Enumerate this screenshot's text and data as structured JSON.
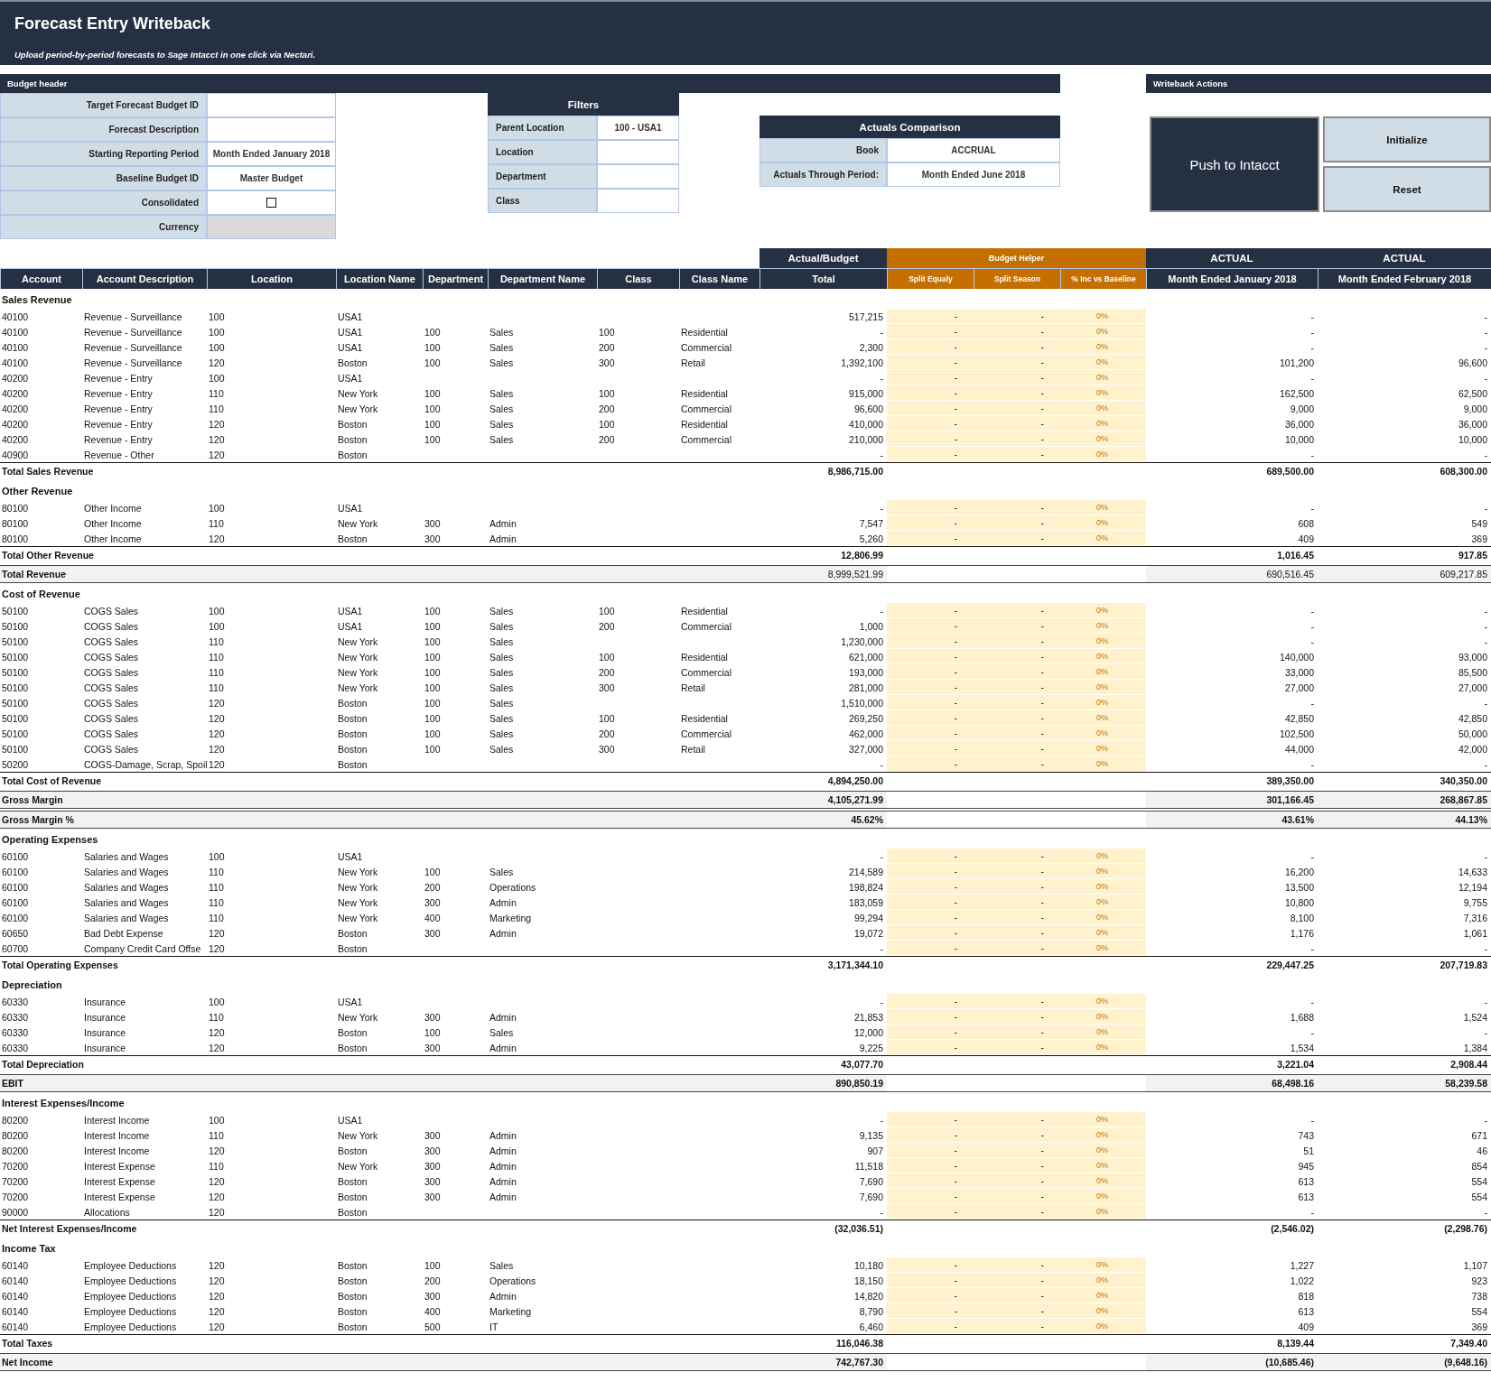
{
  "header": {
    "title": "Forecast Entry Writeback",
    "subtitle": "Upload period-by-period forecasts to Sage Intacct in one click via Nectari."
  },
  "budget_header": {
    "title": "Budget header",
    "fields": [
      {
        "label": "Target Forecast Budget ID",
        "kind": "text",
        "disabled": false
      },
      {
        "label": "Forecast Description",
        "kind": "text",
        "disabled": false
      },
      {
        "label": "Starting Reporting Period",
        "kind": "text",
        "value": "Month Ended January 2018",
        "disabled": false
      },
      {
        "label": "Baseline Budget ID",
        "kind": "text",
        "value": "Master Budget",
        "disabled": false
      },
      {
        "label": "Consolidated",
        "kind": "checkbox",
        "checked": false,
        "disabled": false
      },
      {
        "label": "Currency",
        "kind": "text",
        "disabled": true
      }
    ]
  },
  "filters": {
    "title": "Filters",
    "fields": [
      {
        "label": "Parent Location",
        "value": "100 - USA1"
      },
      {
        "label": "Location"
      },
      {
        "label": "Department"
      },
      {
        "label": "Class"
      }
    ]
  },
  "actuals_comparison": {
    "title": "Actuals Comparison",
    "fields": [
      {
        "label": "Book",
        "value": "ACCRUAL"
      },
      {
        "label": "Actuals Through Period:",
        "value": "Month Ended June 2018"
      }
    ]
  },
  "writeback_actions": {
    "title": "Writeback Actions",
    "buttons": [
      {
        "label": "Push to Intacct",
        "kind": "primary"
      },
      {
        "label": "Initialize",
        "kind": "secondary"
      },
      {
        "label": "Reset",
        "kind": "secondary"
      }
    ]
  },
  "table": {
    "column_groups": [
      {
        "kind": "plain",
        "columns": [
          "Account",
          "Account Description",
          "Location",
          "Location Name",
          "Department",
          "Department Name",
          "Class",
          "Class Name"
        ]
      },
      {
        "kind": "dark",
        "label": "Actual/Budget",
        "columns": [
          "Total"
        ]
      },
      {
        "kind": "helper",
        "label": "Budget Helper",
        "columns": [
          "Split Equaly",
          "Split Season",
          "% Inc vs Baseline"
        ]
      },
      {
        "kind": "dark",
        "label": "ACTUAL",
        "columns": [
          "Month Ended January 2018"
        ]
      },
      {
        "kind": "dark",
        "label": "ACTUAL",
        "columns": [
          "Month Ended February 2018"
        ]
      }
    ],
    "rows": [
      {
        "kind": "section",
        "label": "Sales Revenue"
      },
      {
        "kind": "line",
        "account": "40100",
        "description": "Revenue - Surveillance",
        "location": "100",
        "location_name": "USA1",
        "total": "517,215",
        "split_equally": "-",
        "split_season": "-",
        "inc_vs_baseline": "0%",
        "actual_jan": "-",
        "actual_feb": "-"
      },
      {
        "kind": "line",
        "account": "40100",
        "description": "Revenue - Surveillance",
        "location": "100",
        "location_name": "USA1",
        "department": "100",
        "department_name": "Sales",
        "class": "100",
        "class_name": "Residential",
        "total": "-",
        "split_equally": "-",
        "split_season": "-",
        "inc_vs_baseline": "0%",
        "actual_jan": "-",
        "actual_feb": "-"
      },
      {
        "kind": "line",
        "account": "40100",
        "description": "Revenue - Surveillance",
        "location": "100",
        "location_name": "USA1",
        "department": "100",
        "department_name": "Sales",
        "class": "200",
        "class_name": "Commercial",
        "total": "2,300",
        "split_equally": "-",
        "split_season": "-",
        "inc_vs_baseline": "0%",
        "actual_jan": "-",
        "actual_feb": "-"
      },
      {
        "kind": "line",
        "account": "40100",
        "description": "Revenue - Surveillance",
        "location": "120",
        "location_name": "Boston",
        "department": "100",
        "department_name": "Sales",
        "class": "300",
        "class_name": "Retail",
        "total": "1,392,100",
        "split_equally": "-",
        "split_season": "-",
        "inc_vs_baseline": "0%",
        "actual_jan": "101,200",
        "actual_feb": "96,600"
      },
      {
        "kind": "line",
        "account": "40200",
        "description": "Revenue - Entry",
        "location": "100",
        "location_name": "USA1",
        "total": "-",
        "split_equally": "-",
        "split_season": "-",
        "inc_vs_baseline": "0%",
        "actual_jan": "-",
        "actual_feb": "-"
      },
      {
        "kind": "line",
        "account": "40200",
        "description": "Revenue - Entry",
        "location": "110",
        "location_name": "New York",
        "department": "100",
        "department_name": "Sales",
        "class": "100",
        "class_name": "Residential",
        "total": "915,000",
        "split_equally": "-",
        "split_season": "-",
        "inc_vs_baseline": "0%",
        "actual_jan": "162,500",
        "actual_feb": "62,500"
      },
      {
        "kind": "line",
        "account": "40200",
        "description": "Revenue - Entry",
        "location": "110",
        "location_name": "New York",
        "department": "100",
        "department_name": "Sales",
        "class": "200",
        "class_name": "Commercial",
        "total": "96,600",
        "split_equally": "-",
        "split_season": "-",
        "inc_vs_baseline": "0%",
        "actual_jan": "9,000",
        "actual_feb": "9,000"
      },
      {
        "kind": "line",
        "account": "40200",
        "description": "Revenue - Entry",
        "location": "120",
        "location_name": "Boston",
        "department": "100",
        "department_name": "Sales",
        "class": "100",
        "class_name": "Residential",
        "total": "410,000",
        "split_equally": "-",
        "split_season": "-",
        "inc_vs_baseline": "0%",
        "actual_jan": "36,000",
        "actual_feb": "36,000"
      },
      {
        "kind": "line",
        "account": "40200",
        "description": "Revenue - Entry",
        "location": "120",
        "location_name": "Boston",
        "department": "100",
        "department_name": "Sales",
        "class": "200",
        "class_name": "Commercial",
        "total": "210,000",
        "split_equally": "-",
        "split_season": "-",
        "inc_vs_baseline": "0%",
        "actual_jan": "10,000",
        "actual_feb": "10,000"
      },
      {
        "kind": "line",
        "account": "40900",
        "description": "Revenue - Other",
        "location": "120",
        "location_name": "Boston",
        "total": "-",
        "split_equally": "-",
        "split_season": "-",
        "inc_vs_baseline": "0%",
        "actual_jan": "-",
        "actual_feb": "-"
      },
      {
        "kind": "total",
        "label": "Total Sales Revenue",
        "total": "8,986,715.00",
        "actual_jan": "689,500.00",
        "actual_feb": "608,300.00"
      },
      {
        "kind": "section",
        "label": "Other Revenue"
      },
      {
        "kind": "line",
        "account": "80100",
        "description": "Other Income",
        "location": "100",
        "location_name": "USA1",
        "total": "-",
        "split_equally": "-",
        "split_season": "-",
        "inc_vs_baseline": "0%",
        "actual_jan": "-",
        "actual_feb": "-"
      },
      {
        "kind": "line",
        "account": "80100",
        "description": "Other Income",
        "location": "110",
        "location_name": "New York",
        "department": "300",
        "department_name": "Admin",
        "total": "7,547",
        "split_equally": "-",
        "split_season": "-",
        "inc_vs_baseline": "0%",
        "actual_jan": "608",
        "actual_feb": "549"
      },
      {
        "kind": "line",
        "account": "80100",
        "description": "Other Income",
        "location": "120",
        "location_name": "Boston",
        "department": "300",
        "department_name": "Admin",
        "total": "5,260",
        "split_equally": "-",
        "split_season": "-",
        "inc_vs_baseline": "0%",
        "actual_jan": "409",
        "actual_feb": "369"
      },
      {
        "kind": "total",
        "label": "Total Other Revenue",
        "total": "12,806.99",
        "actual_jan": "1,016.45",
        "actual_feb": "917.85"
      },
      {
        "kind": "summary",
        "label": "Total Revenue",
        "bold_values": false,
        "total": "8,999,521.99",
        "actual_jan": "690,516.45",
        "actual_feb": "609,217.85"
      },
      {
        "kind": "section",
        "label": "Cost of Revenue"
      },
      {
        "kind": "line",
        "account": "50100",
        "description": "COGS Sales",
        "location": "100",
        "location_name": "USA1",
        "department": "100",
        "department_name": "Sales",
        "class": "100",
        "class_name": "Residential",
        "total": "-",
        "split_equally": "-",
        "split_season": "-",
        "inc_vs_baseline": "0%",
        "actual_jan": "-",
        "actual_feb": "-"
      },
      {
        "kind": "line",
        "account": "50100",
        "description": "COGS Sales",
        "location": "100",
        "location_name": "USA1",
        "department": "100",
        "department_name": "Sales",
        "class": "200",
        "class_name": "Commercial",
        "total": "1,000",
        "split_equally": "-",
        "split_season": "-",
        "inc_vs_baseline": "0%",
        "actual_jan": "-",
        "actual_feb": "-"
      },
      {
        "kind": "line",
        "account": "50100",
        "description": "COGS Sales",
        "location": "110",
        "location_name": "New York",
        "department": "100",
        "department_name": "Sales",
        "total": "1,230,000",
        "split_equally": "-",
        "split_season": "-",
        "inc_vs_baseline": "0%",
        "actual_jan": "-",
        "actual_feb": "-"
      },
      {
        "kind": "line",
        "account": "50100",
        "description": "COGS Sales",
        "location": "110",
        "location_name": "New York",
        "department": "100",
        "department_name": "Sales",
        "class": "100",
        "class_name": "Residential",
        "total": "621,000",
        "split_equally": "-",
        "split_season": "-",
        "inc_vs_baseline": "0%",
        "actual_jan": "140,000",
        "actual_feb": "93,000"
      },
      {
        "kind": "line",
        "account": "50100",
        "description": "COGS Sales",
        "location": "110",
        "location_name": "New York",
        "department": "100",
        "department_name": "Sales",
        "class": "200",
        "class_name": "Commercial",
        "total": "193,000",
        "split_equally": "-",
        "split_season": "-",
        "inc_vs_baseline": "0%",
        "actual_jan": "33,000",
        "actual_feb": "85,500"
      },
      {
        "kind": "line",
        "account": "50100",
        "description": "COGS Sales",
        "location": "110",
        "location_name": "New York",
        "department": "100",
        "department_name": "Sales",
        "class": "300",
        "class_name": "Retail",
        "total": "281,000",
        "split_equally": "-",
        "split_season": "-",
        "inc_vs_baseline": "0%",
        "actual_jan": "27,000",
        "actual_feb": "27,000"
      },
      {
        "kind": "line",
        "account": "50100",
        "description": "COGS Sales",
        "location": "120",
        "location_name": "Boston",
        "department": "100",
        "department_name": "Sales",
        "total": "1,510,000",
        "split_equally": "-",
        "split_season": "-",
        "inc_vs_baseline": "0%",
        "actual_jan": "-",
        "actual_feb": "-"
      },
      {
        "kind": "line",
        "account": "50100",
        "description": "COGS Sales",
        "location": "120",
        "location_name": "Boston",
        "department": "100",
        "department_name": "Sales",
        "class": "100",
        "class_name": "Residential",
        "total": "269,250",
        "split_equally": "-",
        "split_season": "-",
        "inc_vs_baseline": "0%",
        "actual_jan": "42,850",
        "actual_feb": "42,850"
      },
      {
        "kind": "line",
        "account": "50100",
        "description": "COGS Sales",
        "location": "120",
        "location_name": "Boston",
        "department": "100",
        "department_name": "Sales",
        "class": "200",
        "class_name": "Commercial",
        "total": "462,000",
        "split_equally": "-",
        "split_season": "-",
        "inc_vs_baseline": "0%",
        "actual_jan": "102,500",
        "actual_feb": "50,000"
      },
      {
        "kind": "line",
        "account": "50100",
        "description": "COGS Sales",
        "location": "120",
        "location_name": "Boston",
        "department": "100",
        "department_name": "Sales",
        "class": "300",
        "class_name": "Retail",
        "total": "327,000",
        "split_equally": "-",
        "split_season": "-",
        "inc_vs_baseline": "0%",
        "actual_jan": "44,000",
        "actual_feb": "42,000"
      },
      {
        "kind": "line",
        "account": "50200",
        "description": "COGS-Damage, Scrap, Spoil",
        "location": "120",
        "location_name": "Boston",
        "total": "-",
        "split_equally": "-",
        "split_season": "-",
        "inc_vs_baseline": "0%",
        "actual_jan": "-",
        "actual_feb": "-"
      },
      {
        "kind": "total",
        "label": "Total Cost of Revenue",
        "total": "4,894,250.00",
        "actual_jan": "389,350.00",
        "actual_feb": "340,350.00"
      },
      {
        "kind": "summary",
        "label": "Gross Margin",
        "bold_values": true,
        "total": "4,105,271.99",
        "actual_jan": "301,166.45",
        "actual_feb": "268,867.85"
      },
      {
        "kind": "summary",
        "label": "Gross Margin %",
        "bold_values": true,
        "total": "45.62%",
        "actual_jan": "43.61%",
        "actual_feb": "44.13%"
      },
      {
        "kind": "section",
        "label": "Operating Expenses"
      },
      {
        "kind": "line",
        "account": "60100",
        "description": "Salaries and Wages",
        "location": "100",
        "location_name": "USA1",
        "total": "-",
        "split_equally": "-",
        "split_season": "-",
        "inc_vs_baseline": "0%",
        "actual_jan": "-",
        "actual_feb": "-"
      },
      {
        "kind": "line",
        "account": "60100",
        "description": "Salaries and Wages",
        "location": "110",
        "location_name": "New York",
        "department": "100",
        "department_name": "Sales",
        "total": "214,589",
        "split_equally": "-",
        "split_season": "-",
        "inc_vs_baseline": "0%",
        "actual_jan": "16,200",
        "actual_feb": "14,633"
      },
      {
        "kind": "line",
        "account": "60100",
        "description": "Salaries and Wages",
        "location": "110",
        "location_name": "New York",
        "department": "200",
        "department_name": "Operations",
        "total": "198,824",
        "split_equally": "-",
        "split_season": "-",
        "inc_vs_baseline": "0%",
        "actual_jan": "13,500",
        "actual_feb": "12,194"
      },
      {
        "kind": "line",
        "account": "60100",
        "description": "Salaries and Wages",
        "location": "110",
        "location_name": "New York",
        "department": "300",
        "department_name": "Admin",
        "total": "183,059",
        "split_equally": "-",
        "split_season": "-",
        "inc_vs_baseline": "0%",
        "actual_jan": "10,800",
        "actual_feb": "9,755"
      },
      {
        "kind": "line",
        "account": "60100",
        "description": "Salaries and Wages",
        "location": "110",
        "location_name": "New York",
        "department": "400",
        "department_name": "Marketing",
        "total": "99,294",
        "split_equally": "-",
        "split_season": "-",
        "inc_vs_baseline": "0%",
        "actual_jan": "8,100",
        "actual_feb": "7,316"
      },
      {
        "kind": "line",
        "account": "60650",
        "description": "Bad Debt Expense",
        "location": "120",
        "location_name": "Boston",
        "department": "300",
        "department_name": "Admin",
        "total": "19,072",
        "split_equally": "-",
        "split_season": "-",
        "inc_vs_baseline": "0%",
        "actual_jan": "1,176",
        "actual_feb": "1,061"
      },
      {
        "kind": "line",
        "account": "60700",
        "description": "Company Credit Card Offse",
        "location": "120",
        "location_name": "Boston",
        "total": "-",
        "split_equally": "-",
        "split_season": "-",
        "inc_vs_baseline": "0%",
        "actual_jan": "-",
        "actual_feb": "-"
      },
      {
        "kind": "total",
        "label": "Total Operating Expenses",
        "total": "3,171,344.10",
        "actual_jan": "229,447.25",
        "actual_feb": "207,719.83"
      },
      {
        "kind": "section",
        "label": "Depreciation"
      },
      {
        "kind": "line",
        "account": "60330",
        "description": "Insurance",
        "location": "100",
        "location_name": "USA1",
        "total": "-",
        "split_equally": "-",
        "split_season": "-",
        "inc_vs_baseline": "0%",
        "actual_jan": "-",
        "actual_feb": "-"
      },
      {
        "kind": "line",
        "account": "60330",
        "description": "Insurance",
        "location": "110",
        "location_name": "New York",
        "department": "300",
        "department_name": "Admin",
        "total": "21,853",
        "split_equally": "-",
        "split_season": "-",
        "inc_vs_baseline": "0%",
        "actual_jan": "1,688",
        "actual_feb": "1,524"
      },
      {
        "kind": "line",
        "account": "60330",
        "description": "Insurance",
        "location": "120",
        "location_name": "Boston",
        "department": "100",
        "department_name": "Sales",
        "total": "12,000",
        "split_equally": "-",
        "split_season": "-",
        "inc_vs_baseline": "0%",
        "actual_jan": "-",
        "actual_feb": "-"
      },
      {
        "kind": "line",
        "account": "60330",
        "description": "Insurance",
        "location": "120",
        "location_name": "Boston",
        "department": "300",
        "department_name": "Admin",
        "total": "9,225",
        "split_equally": "-",
        "split_season": "-",
        "inc_vs_baseline": "0%",
        "actual_jan": "1,534",
        "actual_feb": "1,384"
      },
      {
        "kind": "total",
        "label": "Total Depreciation",
        "total": "43,077.70",
        "actual_jan": "3,221.04",
        "actual_feb": "2,908.44"
      },
      {
        "kind": "summary",
        "label": "EBIT",
        "bold_values": true,
        "total": "890,850.19",
        "actual_jan": "68,498.16",
        "actual_feb": "58,239.58"
      },
      {
        "kind": "section",
        "label": "Interest Expenses/Income"
      },
      {
        "kind": "line",
        "account": "80200",
        "description": "Interest Income",
        "location": "100",
        "location_name": "USA1",
        "total": "-",
        "split_equally": "-",
        "split_season": "-",
        "inc_vs_baseline": "0%",
        "actual_jan": "-",
        "actual_feb": "-"
      },
      {
        "kind": "line",
        "account": "80200",
        "description": "Interest Income",
        "location": "110",
        "location_name": "New York",
        "department": "300",
        "department_name": "Admin",
        "total": "9,135",
        "split_equally": "-",
        "split_season": "-",
        "inc_vs_baseline": "0%",
        "actual_jan": "743",
        "actual_feb": "671"
      },
      {
        "kind": "line",
        "account": "80200",
        "description": "Interest Income",
        "location": "120",
        "location_name": "Boston",
        "department": "300",
        "department_name": "Admin",
        "total": "907",
        "split_equally": "-",
        "split_season": "-",
        "inc_vs_baseline": "0%",
        "actual_jan": "51",
        "actual_feb": "46"
      },
      {
        "kind": "line",
        "account": "70200",
        "description": "Interest Expense",
        "location": "110",
        "location_name": "New York",
        "department": "300",
        "department_name": "Admin",
        "total": "11,518",
        "split_equally": "-",
        "split_season": "-",
        "inc_vs_baseline": "0%",
        "actual_jan": "945",
        "actual_feb": "854"
      },
      {
        "kind": "line",
        "account": "70200",
        "description": "Interest Expense",
        "location": "120",
        "location_name": "Boston",
        "department": "300",
        "department_name": "Admin",
        "total": "7,690",
        "split_equally": "-",
        "split_season": "-",
        "inc_vs_baseline": "0%",
        "actual_jan": "613",
        "actual_feb": "554"
      },
      {
        "kind": "line",
        "account": "70200",
        "description": "Interest Expense",
        "location": "120",
        "location_name": "Boston",
        "department": "300",
        "department_name": "Admin",
        "total": "7,690",
        "split_equally": "-",
        "split_season": "-",
        "inc_vs_baseline": "0%",
        "actual_jan": "613",
        "actual_feb": "554"
      },
      {
        "kind": "line",
        "account": "90000",
        "description": "Allocations",
        "location": "120",
        "location_name": "Boston",
        "total": "-",
        "split_equally": "-",
        "split_season": "-",
        "inc_vs_baseline": "0%",
        "actual_jan": "-",
        "actual_feb": "-"
      },
      {
        "kind": "total",
        "label": "Net Interest Expenses/Income",
        "total": "(32,036.51)",
        "actual_jan": "(2,546.02)",
        "actual_feb": "(2,298.76)"
      },
      {
        "kind": "section",
        "label": "Income Tax"
      },
      {
        "kind": "line",
        "account": "60140",
        "description": "Employee Deductions",
        "location": "120",
        "location_name": "Boston",
        "department": "100",
        "department_name": "Sales",
        "total": "10,180",
        "split_equally": "-",
        "split_season": "-",
        "inc_vs_baseline": "0%",
        "actual_jan": "1,227",
        "actual_feb": "1,107"
      },
      {
        "kind": "line",
        "account": "60140",
        "description": "Employee Deductions",
        "location": "120",
        "location_name": "Boston",
        "department": "200",
        "department_name": "Operations",
        "total": "18,150",
        "split_equally": "-",
        "split_season": "-",
        "inc_vs_baseline": "0%",
        "actual_jan": "1,022",
        "actual_feb": "923"
      },
      {
        "kind": "line",
        "account": "60140",
        "description": "Employee Deductions",
        "location": "120",
        "location_name": "Boston",
        "department": "300",
        "department_name": "Admin",
        "total": "14,820",
        "split_equally": "-",
        "split_season": "-",
        "inc_vs_baseline": "0%",
        "actual_jan": "818",
        "actual_feb": "738"
      },
      {
        "kind": "line",
        "account": "60140",
        "description": "Employee Deductions",
        "location": "120",
        "location_name": "Boston",
        "department": "400",
        "department_name": "Marketing",
        "total": "8,790",
        "split_equally": "-",
        "split_season": "-",
        "inc_vs_baseline": "0%",
        "actual_jan": "613",
        "actual_feb": "554"
      },
      {
        "kind": "line",
        "account": "60140",
        "description": "Employee Deductions",
        "location": "120",
        "location_name": "Boston",
        "department": "500",
        "department_name": "IT",
        "total": "6,460",
        "split_equally": "-",
        "split_season": "-",
        "inc_vs_baseline": "0%",
        "actual_jan": "409",
        "actual_feb": "369"
      },
      {
        "kind": "total",
        "label": "Total Taxes",
        "total": "116,046.38",
        "actual_jan": "8,139.44",
        "actual_feb": "7,349.40"
      },
      {
        "kind": "summary",
        "label": "Net Income",
        "bold_values": true,
        "total": "742,767.30",
        "actual_jan": "(10,685.46)",
        "actual_feb": "(9,648.16)"
      }
    ]
  }
}
